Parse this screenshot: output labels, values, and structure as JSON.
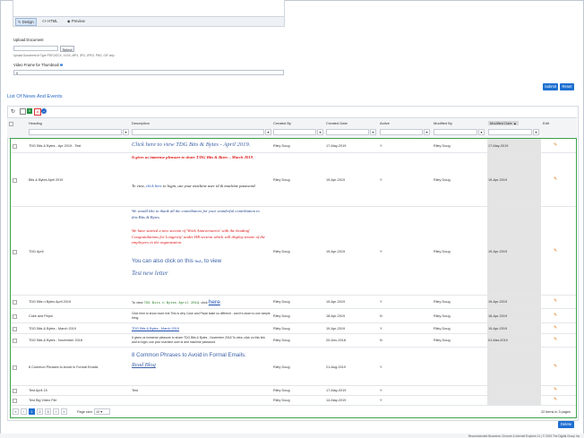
{
  "editor": {
    "tabs": [
      {
        "label": "Design",
        "icon": "design-icon",
        "active": true
      },
      {
        "label": "HTML",
        "icon": "code-icon",
        "active": false
      },
      {
        "label": "Preview",
        "icon": "eye-icon",
        "active": false
      }
    ]
  },
  "upload": {
    "label": "Upload Document",
    "select_label": "Select",
    "hint": "Upload Document of Type PDF,DOCX, XLSX, MP4, JPG, JPEG, PNG, GIF only"
  },
  "video": {
    "label": "Video Frame for Thumbnail",
    "value": "0"
  },
  "actions": {
    "submit": "Submit",
    "reset": "Reset",
    "delete": "Delete"
  },
  "section_title": "List Of News And Events",
  "columns": {
    "heading": "Heading",
    "description": "Description",
    "created_by": "Created By",
    "created_date": "Created Date",
    "active": "Active",
    "modified_by": "Modified By",
    "modified_date": "Modified Date",
    "edit": "Edit"
  },
  "rows": [
    {
      "heading": "TDG Bits & Bytes - Apr 2019 - Test",
      "created_by": "Riley Doug",
      "created_date": "17-May-2019",
      "active": "Y",
      "modified_by": "Riley Doug",
      "modified_date": "17-May-2019"
    },
    {
      "heading": "Bits & Bytes April 2019",
      "created_by": "Riley Doug",
      "created_date": "19-Apr-2019",
      "active": "Y",
      "modified_by": "Riley Doug",
      "modified_date": "19-Apr-2019"
    },
    {
      "heading": "TDG April",
      "created_by": "Riley Doug",
      "created_date": "19-Apr-2019",
      "active": "Y",
      "modified_by": "Riley Doug",
      "modified_date": "19-Apr-2019"
    },
    {
      "heading": "TDG Bits n Bytes April 2019",
      "created_by": "Riley Doug",
      "created_date": "19-Apr-2019",
      "active": "Y",
      "modified_by": "Riley Doug",
      "modified_date": "19-Apr-2019"
    },
    {
      "heading": "Coke and Pepsi",
      "created_by": "Riley Doug",
      "created_date": "18-Apr-2019",
      "active": "N",
      "modified_by": "Riley Doug",
      "modified_date": "18-Apr-2019"
    },
    {
      "heading": "TDG Bits & Bytes - March 2019",
      "created_by": "Riley Doug",
      "created_date": "19-Apr-2019",
      "active": "Y",
      "modified_by": "Riley Doug",
      "modified_date": "19-Apr-2019"
    },
    {
      "heading": "TDG Bits & Bytes - November 2018",
      "created_by": "Riley Doug",
      "created_date": "20-Dec-2018",
      "active": "N",
      "modified_by": "Riley Doug",
      "modified_date": "01-Mar-2019"
    },
    {
      "heading": "8 Common Phrases to Avoid in Formal Emails",
      "created_by": "Riley Doug",
      "created_date": "21-Aug-2019",
      "active": "Y",
      "modified_by": "",
      "modified_date": ""
    },
    {
      "heading": "Test April 15",
      "description": "Test",
      "created_by": "Riley Doug",
      "created_date": "17-May-2019",
      "active": "Y",
      "modified_by": "",
      "modified_date": ""
    },
    {
      "heading": "Test Big Video File",
      "created_by": "Riley Doug",
      "created_date": "14-May-2019",
      "active": "Y",
      "modified_by": "",
      "modified_date": ""
    }
  ],
  "desc": {
    "r1_link": "Click here to view TDG Bits & Bytes - April 2019.",
    "r2_red": "It gives us immense pleasure to share T/DG Bits & Bytes – March 2019.",
    "r2_pre": "To view, ",
    "r2_link": "click here",
    "r2_post": " to login, use your machine user id & machine password.",
    "r3_intro": "We would like to thank all the contributors for your wonderful contribution to this Bits & Bytes.",
    "r3_red": "We have started a new section of 'Work Anniversaries' with the heading' Congratulations for Longevity' under HR section which will display tenure of the employees in the organization.",
    "r3_pre": "You can also click on this ",
    "r3_link": "link",
    "r3_post": ", to view",
    "r3_test": "Test new letter",
    "r4_pre": "To view ",
    "r4_code": "TDG Bits n Bytes April 2019",
    "r4_mid": ", click ",
    "r4_link": "here",
    "r4_end": ".",
    "r5": "Click here to know more link This is why Coke and Pepsi taste so different - and it's down to one simple thing",
    "r6_link": "TDG Bits & Bytes - March 2019",
    "r7": "It gives us immense pleasure to share TDG Bits & Bytes - November 2018 To view, click on this link and to login, use your machine user id and machine password.",
    "r8_title": "8 Common Phrases to Avoid in Formal Emails.",
    "r8_link": "Read Blog"
  },
  "pager": {
    "pages": [
      "1",
      "2",
      "3"
    ],
    "page_size_label": "Page size:",
    "page_size": "10",
    "summary": "22 items in 3 pages"
  },
  "footer": "Recommended Browsers: Chrome & Internet Explorer 11 | © 2019 The Digital Group Inc."
}
